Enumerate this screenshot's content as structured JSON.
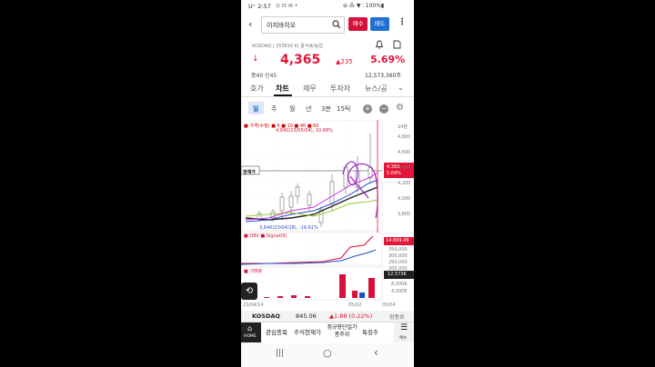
{
  "status_bar": {
    "time": "U⁺ 2:57",
    "icons": "⊙ ⊡ ✉ •",
    "right": "⊖ ⁂ ▼ ⫶ 100%▮"
  },
  "header": {
    "search_text": "이지바이오",
    "buy_label": "매수",
    "sell_label": "매도",
    "buy_color": "#d6123c",
    "sell_color": "#1f6fd6"
  },
  "stock": {
    "market_info": "KOSDAQ  |  353810 K|  음식료/농업",
    "price": "4,365",
    "change_arrow": "▲",
    "change": "235",
    "percent": "5.69%",
    "volume": "12,573,360주",
    "sub_label": "종40  신45",
    "up_color": "#e3163a"
  },
  "tabs": [
    "호가",
    "차트",
    "재무",
    "투자자",
    "뉴스/공"
  ],
  "periods": [
    "일",
    "주",
    "월",
    "년",
    "3분",
    "15틱"
  ],
  "chart": {
    "legend_price": "■ 가격(수정)  ■ 5  ■ 10  ■ 40  ■ 60",
    "high_annotation": "4,840(23/05/04), 10.88%",
    "low_annotation": "3,640(23/04/28), -16.61%",
    "current_label": "현재가",
    "current_price": "4,365",
    "current_pct": "5.69%",
    "right_header": "14분",
    "price_ticks": [
      "4,800",
      "4,600",
      "4,400",
      "4,200",
      "4,000",
      "3,800"
    ],
    "obv_legend": "■ OBV  ■ Signal(9)",
    "obv_value": "14,669.49",
    "obv_ticks": [
      "350,000",
      "300,000",
      "250,000",
      "200,000"
    ],
    "volume_label": "■ 거래량",
    "volume_value": "12.573K",
    "volume_ticks": [
      "8,000K",
      "4,000K"
    ],
    "date_left": "23/04/14",
    "date_mid": "05/02",
    "date_right": "05/04"
  },
  "chart_data": {
    "type": "line",
    "series": [
      {
        "name": "OBV",
        "values": [
          160000,
          165000,
          170000,
          175000,
          190000,
          260000,
          280000,
          360000
        ]
      },
      {
        "name": "Signal(9)",
        "values": [
          150000,
          155000,
          160000,
          170000,
          185000,
          200000,
          220000,
          240000
        ]
      }
    ],
    "volume_bars": [
      1000,
      900,
      950,
      1200,
      1100,
      8000,
      1500,
      9000
    ]
  },
  "index_bar": {
    "index_name": "KOSDAQ",
    "index_value": "845.06",
    "index_change": "▲1.88 (0.22%)",
    "market_status": "장종료"
  },
  "bottom_nav": {
    "home": "HOME",
    "watchlist": "관심종목",
    "current": "주식현재가",
    "fast": "정규장단일가종주위",
    "special": "특징주",
    "menu": "메뉴"
  },
  "sys_nav": {
    "recent": "|||",
    "home": "○",
    "back": "‹"
  }
}
